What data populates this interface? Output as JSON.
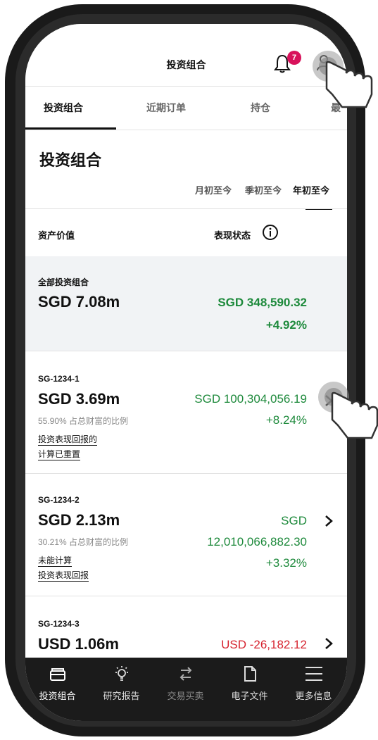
{
  "header": {
    "title": "投资组合",
    "notification_count": "7"
  },
  "tabs": [
    {
      "label": "投资组合"
    },
    {
      "label": "近期订单"
    },
    {
      "label": "持仓"
    },
    {
      "label": "最"
    }
  ],
  "section": {
    "title": "投资组合"
  },
  "periods": [
    {
      "label": "月初至今"
    },
    {
      "label": "季初至今"
    },
    {
      "label": "年初至今"
    }
  ],
  "columns": {
    "asset_value": "资产价值",
    "performance": "表现状态"
  },
  "total": {
    "label": "全部投资组合",
    "amount": "SGD 7.08m",
    "gain": "SGD 348,590.32",
    "pct": "+4.92%"
  },
  "accounts": [
    {
      "id": "SG-1234-1",
      "amount": "SGD 3.69m",
      "share": "55.90% 占总财富的比例",
      "gain": "SGD 100,304,056.19",
      "pct": "+8.24%",
      "note_line1": "投资表现回报的",
      "note_line2": "计算已重置"
    },
    {
      "id": "SG-1234-2",
      "amount": "SGD 2.13m",
      "share": "30.21% 占总财富的比例",
      "gain_line1": "SGD",
      "gain_line2": "12,010,066,882.30",
      "pct": "+3.32%",
      "note_line1": "未能计算",
      "note_line2": "投资表现回报"
    },
    {
      "id": "SG-1234-3",
      "amount": "USD 1.06m",
      "gain": "USD -26,182.12"
    }
  ],
  "bottom_nav": [
    {
      "label": "投资组合",
      "icon": "wallet-icon"
    },
    {
      "label": "研究报告",
      "icon": "lightbulb-icon"
    },
    {
      "label": "交易买卖",
      "icon": "transfer-arrows-icon"
    },
    {
      "label": "电子文件",
      "icon": "document-icon"
    },
    {
      "label": "更多信息",
      "icon": "menu-icon"
    }
  ],
  "colors": {
    "positive": "#1e8a3c",
    "negative": "#d6232f",
    "badge": "#d8125b"
  }
}
